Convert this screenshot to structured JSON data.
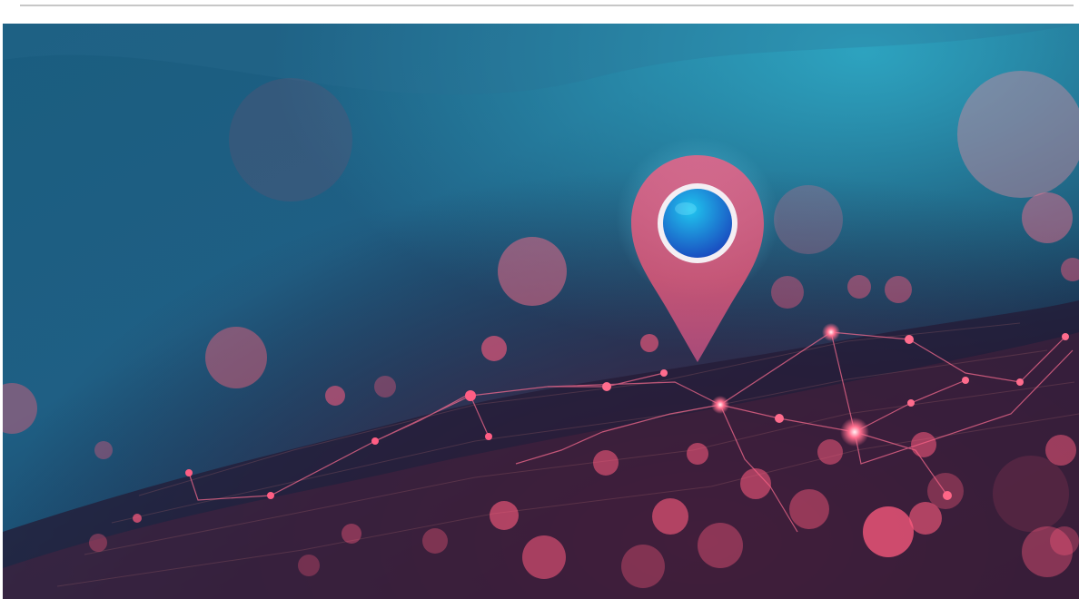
{
  "hero_image": {
    "subject": "location-pin-over-network",
    "colors": {
      "sky_top": "#1f8aa8",
      "sky_mid": "#173f63",
      "sky_bottom": "#151b36",
      "pin_fill": "#e0587a",
      "pin_ring": "#f3e9ef",
      "pin_center": "#1f7dd0",
      "node_color": "#ff5b7f",
      "bokeh_color": "#f0657f"
    },
    "icons": {
      "pin": "map-pin-icon"
    }
  }
}
